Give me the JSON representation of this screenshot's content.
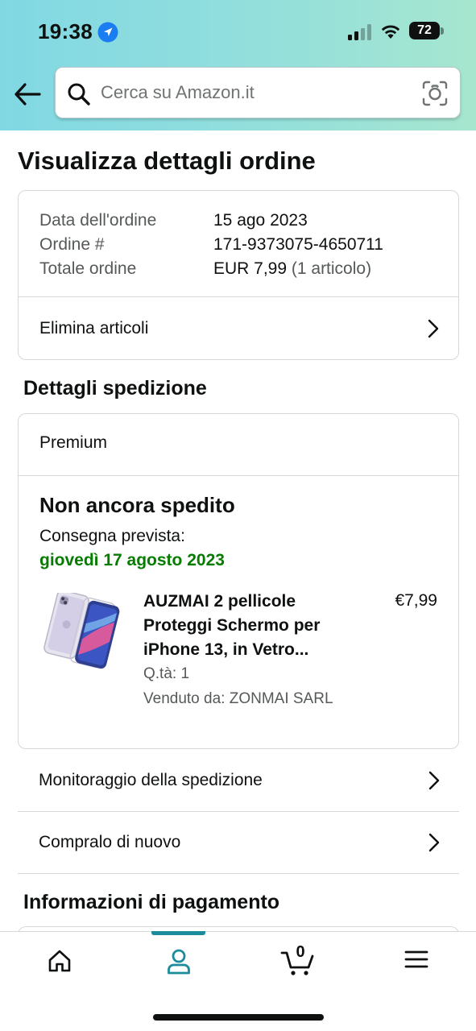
{
  "status_bar": {
    "time": "19:38",
    "battery": "72"
  },
  "search": {
    "placeholder": "Cerca su Amazon.it",
    "value": ""
  },
  "page": {
    "title": "Visualizza dettagli ordine"
  },
  "order": {
    "rows": [
      {
        "label": "Data dell'ordine",
        "value": "15 ago 2023",
        "extra": ""
      },
      {
        "label": "Ordine #",
        "value": "171-9373075-4650711",
        "extra": ""
      },
      {
        "label": "Totale ordine",
        "value": "EUR 7,99",
        "extra": " (1 articolo)"
      }
    ],
    "remove_items_label": "Elimina articoli"
  },
  "shipment": {
    "section_title": "Dettagli spedizione",
    "shipping_type": "Premium",
    "status": "Non ancora spedito",
    "delivery_label": "Consegna prevista:",
    "delivery_date": "giovedì 17 agosto 2023",
    "product": {
      "title": "AUZMAI 2 pellicole Proteggi Schermo per iPhone 13, in Vetro...",
      "price": "€7,99",
      "qty": "Q.tà: 1",
      "seller": "Venduto da: ZONMAI SARL"
    },
    "track_label": "Monitoraggio della spedizione",
    "buy_again_label": "Compralo di nuovo"
  },
  "payment": {
    "section_title": "Informazioni di pagamento"
  },
  "tabbar": {
    "cart_count": "0",
    "active_tab": "account"
  },
  "colors": {
    "header_gradient_start": "#81d8e3",
    "header_gradient_end": "#a6e6cf",
    "delivery_green": "#067d00",
    "active_tab": "#1a8c9b",
    "border": "#d5d9d9"
  }
}
